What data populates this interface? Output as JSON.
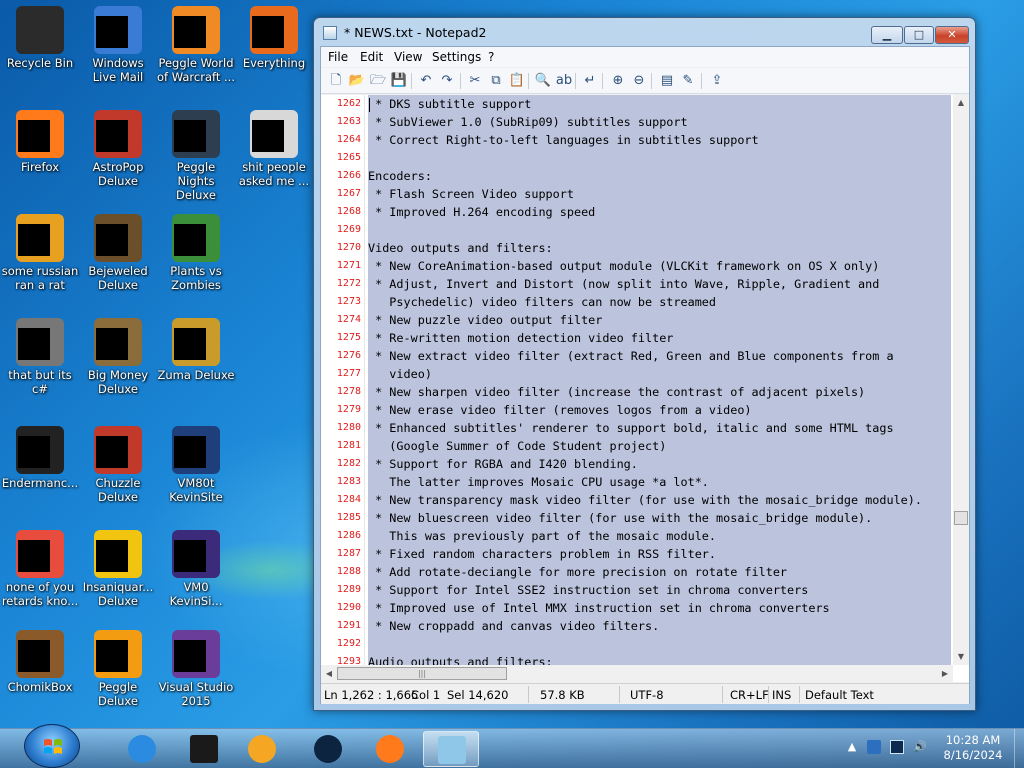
{
  "desktop": {
    "icons": [
      {
        "label": "Recycle Bin",
        "icon": "recycle-bin-icon"
      },
      {
        "label": "Windows Live Mail",
        "icon": "windows-live-mail-icon"
      },
      {
        "label": "Peggle World of Warcraft ...",
        "icon": "peggle-wow-icon"
      },
      {
        "label": "Everything",
        "icon": "everything-icon"
      },
      {
        "label": "Firefox",
        "icon": "firefox-icon"
      },
      {
        "label": "AstroPop Deluxe",
        "icon": "astropop-icon"
      },
      {
        "label": "Peggle Nights Deluxe",
        "icon": "peggle-nights-icon"
      },
      {
        "label": "shit people asked me ...",
        "icon": "folder-icon"
      },
      {
        "label": "some russian ran a rat",
        "icon": "shortcut-icon"
      },
      {
        "label": "Bejeweled Deluxe",
        "icon": "bejeweled-icon"
      },
      {
        "label": "Plants vs Zombies",
        "icon": "plants-vs-zombies-icon"
      },
      {
        "label": "that but its c#",
        "icon": "windows-stack-icon"
      },
      {
        "label": "Big Money Deluxe",
        "icon": "big-money-icon"
      },
      {
        "label": "Zuma Deluxe",
        "icon": "zuma-icon"
      },
      {
        "label": "Endermanc...",
        "icon": "app-window-icon"
      },
      {
        "label": "Chuzzle Deluxe",
        "icon": "chuzzle-icon"
      },
      {
        "label": "VM80t KevinSite",
        "icon": "vm-icon"
      },
      {
        "label": "none of you retards kno...",
        "icon": "shortcut-icon"
      },
      {
        "label": "Insaniquar... Deluxe",
        "icon": "insaniquarium-icon"
      },
      {
        "label": "VM0 KevinSi...",
        "icon": "vm-icon"
      },
      {
        "label": "ChomikBox",
        "icon": "chomikbox-icon"
      },
      {
        "label": "Peggle Deluxe",
        "icon": "peggle-icon"
      },
      {
        "label": "Visual Studio 2015",
        "icon": "visual-studio-icon"
      }
    ]
  },
  "window": {
    "title": "* NEWS.txt - Notepad2",
    "caption": {
      "minimize": "▁",
      "maximize": "□",
      "close": "✕"
    },
    "menu": [
      "File",
      "Edit",
      "View",
      "Settings",
      "?"
    ]
  },
  "toolbar": {
    "buttons": [
      {
        "name": "new-file-icon",
        "glyph": "🗋"
      },
      {
        "name": "open-folder-icon",
        "glyph": "📂"
      },
      {
        "name": "browse-icon",
        "glyph": "🗁"
      },
      {
        "name": "save-icon",
        "glyph": "💾"
      },
      {
        "name": "undo-icon",
        "glyph": "↶"
      },
      {
        "name": "redo-icon",
        "glyph": "↷"
      },
      {
        "name": "cut-icon",
        "glyph": "✂"
      },
      {
        "name": "copy-icon",
        "glyph": "⧉"
      },
      {
        "name": "paste-icon",
        "glyph": "📋"
      },
      {
        "name": "find-icon",
        "glyph": "🔍"
      },
      {
        "name": "replace-icon",
        "glyph": "ab"
      },
      {
        "name": "word-wrap-icon",
        "glyph": "↵"
      },
      {
        "name": "zoom-in-icon",
        "glyph": "⊕"
      },
      {
        "name": "zoom-out-icon",
        "glyph": "⊖"
      },
      {
        "name": "scheme-icon",
        "glyph": "▤"
      },
      {
        "name": "settings-icon",
        "glyph": "✎"
      },
      {
        "name": "launch-icon",
        "glyph": "⇪"
      }
    ]
  },
  "editor": {
    "lines": [
      {
        "n": "1262",
        "text": " * DKS subtitle support"
      },
      {
        "n": "1263",
        "text": " * SubViewer 1.0 (SubRip09) subtitles support"
      },
      {
        "n": "1264",
        "text": " * Correct Right-to-left languages in subtitles support"
      },
      {
        "n": "1265",
        "text": ""
      },
      {
        "n": "1266",
        "text": "Encoders:"
      },
      {
        "n": "1267",
        "text": " * Flash Screen Video support"
      },
      {
        "n": "1268",
        "text": " * Improved H.264 encoding speed"
      },
      {
        "n": "1269",
        "text": ""
      },
      {
        "n": "1270",
        "text": "Video outputs and filters:"
      },
      {
        "n": "1271",
        "text": " * New CoreAnimation-based output module (VLCKit framework on OS X only)"
      },
      {
        "n": "1272",
        "text": " * Adjust, Invert and Distort (now split into Wave, Ripple, Gradient and"
      },
      {
        "n": "1273",
        "text": "   Psychedelic) video filters can now be streamed"
      },
      {
        "n": "1274",
        "text": " * New puzzle video output filter"
      },
      {
        "n": "1275",
        "text": " * Re-written motion detection video filter"
      },
      {
        "n": "1276",
        "text": " * New extract video filter (extract Red, Green and Blue components from a"
      },
      {
        "n": "1277",
        "text": "   video)"
      },
      {
        "n": "1278",
        "text": " * New sharpen video filter (increase the contrast of adjacent pixels)"
      },
      {
        "n": "1279",
        "text": " * New erase video filter (removes logos from a video)"
      },
      {
        "n": "1280",
        "text": " * Enhanced subtitles' renderer to support bold, italic and some HTML tags"
      },
      {
        "n": "1281",
        "text": "   (Google Summer of Code Student project)"
      },
      {
        "n": "1282",
        "text": " * Support for RGBA and I420 blending."
      },
      {
        "n": "1283",
        "text": "   The latter improves Mosaic CPU usage *a lot*."
      },
      {
        "n": "1284",
        "text": " * New transparency mask video filter (for use with the mosaic_bridge module)."
      },
      {
        "n": "1285",
        "text": " * New bluescreen video filter (for use with the mosaic_bridge module)."
      },
      {
        "n": "1286",
        "text": "   This was previously part of the mosaic module."
      },
      {
        "n": "1287",
        "text": " * Fixed random characters problem in RSS filter."
      },
      {
        "n": "1288",
        "text": " * Add rotate-deciangle for more precision on rotate filter"
      },
      {
        "n": "1289",
        "text": " * Support for Intel SSE2 instruction set in chroma converters"
      },
      {
        "n": "1290",
        "text": " * Improved use of Intel MMX instruction set in chroma converters"
      },
      {
        "n": "1291",
        "text": " * New croppadd and canvas video filters."
      },
      {
        "n": "1292",
        "text": ""
      },
      {
        "n": "1293",
        "text": "Audio outputs and filters:"
      }
    ]
  },
  "statusbar": {
    "position": "Ln 1,262 : 1,665",
    "column": "Col 1",
    "selection": "Sel 14,620",
    "size": "57.8 KB",
    "encoding": "UTF-8",
    "line_endings": "CR+LF",
    "mode": "INS",
    "scheme": "Default Text"
  },
  "taskbar": {
    "pinned": [
      {
        "name": "internet-explorer-icon",
        "color": "#2a8be0"
      },
      {
        "name": "app-black-icon",
        "color": "#1a1a1a"
      },
      {
        "name": "media-player-icon",
        "color": "#f5a623"
      },
      {
        "name": "dark-orb-icon",
        "color": "#0d2440"
      },
      {
        "name": "firefox-icon",
        "color": "#ff7a1a"
      },
      {
        "name": "notepad2-icon",
        "color": "#8fc7e8"
      }
    ],
    "clock_time": "10:28 AM",
    "clock_date": "8/16/2024"
  }
}
